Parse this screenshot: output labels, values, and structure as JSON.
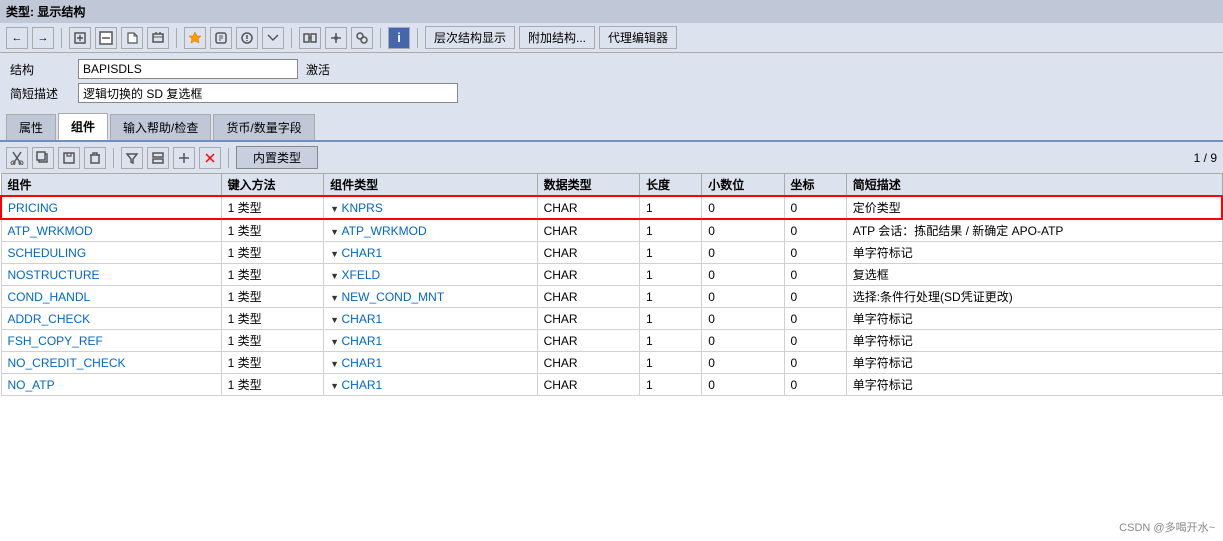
{
  "title": "类型: 显示结构",
  "toolbar": {
    "buttons": [
      "←",
      "→",
      "📄",
      "📋",
      "📁",
      "✏️",
      "⊕",
      "📊",
      "📋",
      "ℹ️"
    ],
    "text_buttons": [
      "层次结构显示",
      "附加结构...",
      "代理编辑器"
    ]
  },
  "form": {
    "structure_label": "结构",
    "structure_value": "BAPISDLS",
    "active_label": "激活",
    "description_label": "简短描述",
    "description_value": "逻辑切换的 SD 复选框"
  },
  "tabs": [
    {
      "id": "attributes",
      "label": "属性"
    },
    {
      "id": "components",
      "label": "组件",
      "active": true
    },
    {
      "id": "input_help",
      "label": "输入帮助/检查"
    },
    {
      "id": "currency",
      "label": "货币/数量字段"
    }
  ],
  "table_toolbar": {
    "inner_type_label": "内置类型",
    "page_current": "1",
    "page_total": "9"
  },
  "table": {
    "columns": [
      "组件",
      "键入方法",
      "组件类型",
      "数据类型",
      "长度",
      "小数位",
      "坐标",
      "简短描述"
    ],
    "rows": [
      {
        "component": "PRICING",
        "key_method": "1 类型",
        "component_type": "KNPRS",
        "data_type": "CHAR",
        "length": "1",
        "decimals": "0",
        "coord": "0",
        "description": "定价类型",
        "highlighted": true
      },
      {
        "component": "ATP_WRKMOD",
        "key_method": "1 类型",
        "component_type": "ATP_WRKMOD",
        "data_type": "CHAR",
        "length": "1",
        "decimals": "0",
        "coord": "0",
        "description": "ATP 会话：拣配结果 / 新确定 APO-ATP",
        "highlighted": false
      },
      {
        "component": "SCHEDULING",
        "key_method": "1 类型",
        "component_type": "CHAR1",
        "data_type": "CHAR",
        "length": "1",
        "decimals": "0",
        "coord": "0",
        "description": "单字符标记",
        "highlighted": false
      },
      {
        "component": "NOSTRUCTURE",
        "key_method": "1 类型",
        "component_type": "XFELD",
        "data_type": "CHAR",
        "length": "1",
        "decimals": "0",
        "coord": "0",
        "description": "复选框",
        "highlighted": false
      },
      {
        "component": "COND_HANDL",
        "key_method": "1 类型",
        "component_type": "NEW_COND_MNT",
        "data_type": "CHAR",
        "length": "1",
        "decimals": "0",
        "coord": "0",
        "description": "选择:条件行处理(SD凭证更改)",
        "highlighted": false
      },
      {
        "component": "ADDR_CHECK",
        "key_method": "1 类型",
        "component_type": "CHAR1",
        "data_type": "CHAR",
        "length": "1",
        "decimals": "0",
        "coord": "0",
        "description": "单字符标记",
        "highlighted": false
      },
      {
        "component": "FSH_COPY_REF",
        "key_method": "1 类型",
        "component_type": "CHAR1",
        "data_type": "CHAR",
        "length": "1",
        "decimals": "0",
        "coord": "0",
        "description": "单字符标记",
        "highlighted": false
      },
      {
        "component": "NO_CREDIT_CHECK",
        "key_method": "1 类型",
        "component_type": "CHAR1",
        "data_type": "CHAR",
        "length": "1",
        "decimals": "0",
        "coord": "0",
        "description": "单字符标记",
        "highlighted": false
      },
      {
        "component": "NO_ATP",
        "key_method": "1 类型",
        "component_type": "CHAR1",
        "data_type": "CHAR",
        "length": "1",
        "decimals": "0",
        "coord": "0",
        "description": "单字符标记",
        "highlighted": false
      }
    ]
  },
  "watermark": "CSDN @多喝开水~"
}
